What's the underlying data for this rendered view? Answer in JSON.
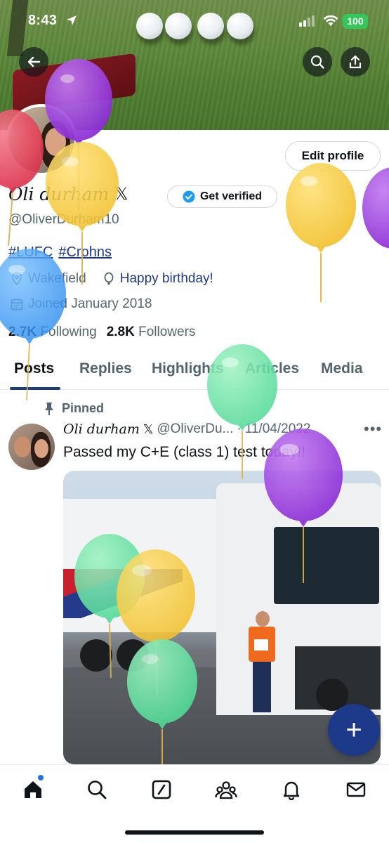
{
  "status_bar": {
    "time": "8:43",
    "battery": "100"
  },
  "profile": {
    "name": "Oli durham",
    "handle": "@OliverDurham10",
    "verify_label": "Get verified",
    "edit_label": "Edit profile",
    "tags": [
      "#LUFC",
      "#Crohns"
    ],
    "location": "Wakefield",
    "birthday": "Happy birthday!",
    "joined": "Joined January 2018",
    "following_count": "2.7K",
    "following_label": "Following",
    "followers_count": "2.8K",
    "followers_label": "Followers"
  },
  "tabs": [
    {
      "label": "Posts",
      "active": true
    },
    {
      "label": "Replies",
      "active": false
    },
    {
      "label": "Highlights",
      "active": false
    },
    {
      "label": "Articles",
      "active": false
    },
    {
      "label": "Media",
      "active": false
    }
  ],
  "post": {
    "pinned_label": "Pinned",
    "author": "Oli durham",
    "handle": "@OliverDu...",
    "separator": "·",
    "date": "11/04/2022",
    "more": "•••",
    "text": "Passed my C+E (class 1) test today!!"
  },
  "fab_label": "+",
  "nav": [
    "home-icon",
    "search-icon",
    "compose-icon",
    "communities-icon",
    "notifications-icon",
    "messages-icon"
  ],
  "colors": {
    "accent": "#1d3a8a",
    "verified": "#1d9bf0",
    "battery": "#34c759"
  },
  "balloons": [
    "purple",
    "red",
    "yellow",
    "yellow",
    "purple",
    "blue",
    "green",
    "purple",
    "green",
    "yellow",
    "green"
  ]
}
